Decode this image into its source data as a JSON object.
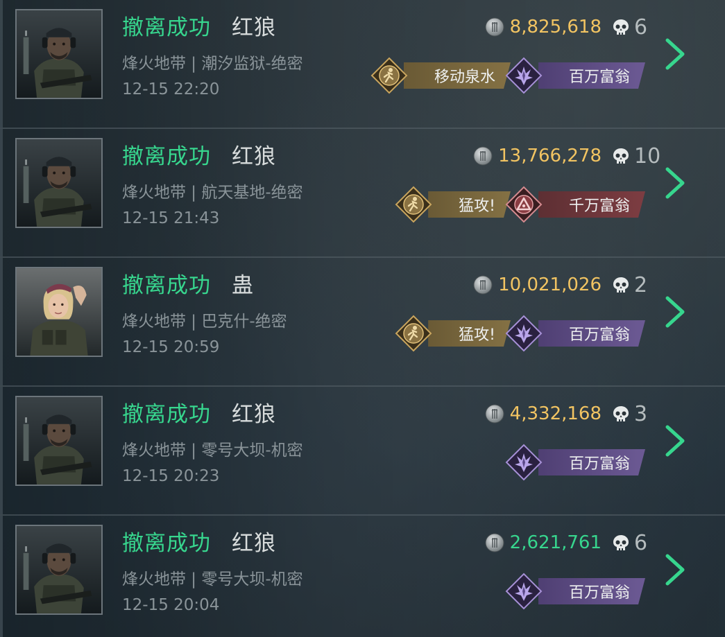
{
  "colors": {
    "status_green": "#37d68e",
    "value_gold": "#f2c462",
    "value_green": "#37d68e",
    "badge_gold": "#7a6a40",
    "badge_purple": "#5e4d86",
    "badge_red": "#7a3a3f"
  },
  "records": [
    {
      "status": "撤离成功",
      "operator": "红狼",
      "avatar": "male-soldier-avatar",
      "location": "烽火地带 | 潮汐监狱-绝密",
      "time": "12-15 22:20",
      "value": "8,825,618",
      "value_color": "gold",
      "kills": "6",
      "badges": [
        {
          "label": "移动泉水",
          "style": "gold",
          "icon": "runner-badge-icon"
        },
        {
          "label": "百万富翁",
          "style": "purple",
          "icon": "crystal-badge-icon"
        }
      ]
    },
    {
      "status": "撤离成功",
      "operator": "红狼",
      "avatar": "male-soldier-avatar",
      "location": "烽火地带 | 航天基地-绝密",
      "time": "12-15 21:43",
      "value": "13,766,278",
      "value_color": "gold",
      "kills": "10",
      "badges": [
        {
          "label": "猛攻!",
          "style": "gold",
          "icon": "runner-badge-icon"
        },
        {
          "label": "千万富翁",
          "style": "red",
          "icon": "triangle-badge-icon"
        }
      ]
    },
    {
      "status": "撤离成功",
      "operator": "蛊",
      "avatar": "female-soldier-avatar",
      "location": "烽火地带 | 巴克什-绝密",
      "time": "12-15 20:59",
      "value": "10,021,026",
      "value_color": "gold",
      "kills": "2",
      "badges": [
        {
          "label": "猛攻!",
          "style": "gold",
          "icon": "runner-badge-icon"
        },
        {
          "label": "百万富翁",
          "style": "purple",
          "icon": "crystal-badge-icon"
        }
      ]
    },
    {
      "status": "撤离成功",
      "operator": "红狼",
      "avatar": "male-soldier-avatar",
      "location": "烽火地带 | 零号大坝-机密",
      "time": "12-15 20:23",
      "value": "4,332,168",
      "value_color": "gold",
      "kills": "3",
      "badges": [
        {
          "label": "百万富翁",
          "style": "purple",
          "icon": "crystal-badge-icon"
        }
      ]
    },
    {
      "status": "撤离成功",
      "operator": "红狼",
      "avatar": "male-soldier-avatar",
      "location": "烽火地带 | 零号大坝-机密",
      "time": "12-15 20:04",
      "value": "2,621,761",
      "value_color": "green",
      "kills": "6",
      "badges": [
        {
          "label": "百万富翁",
          "style": "purple",
          "icon": "crystal-badge-icon"
        }
      ]
    }
  ]
}
